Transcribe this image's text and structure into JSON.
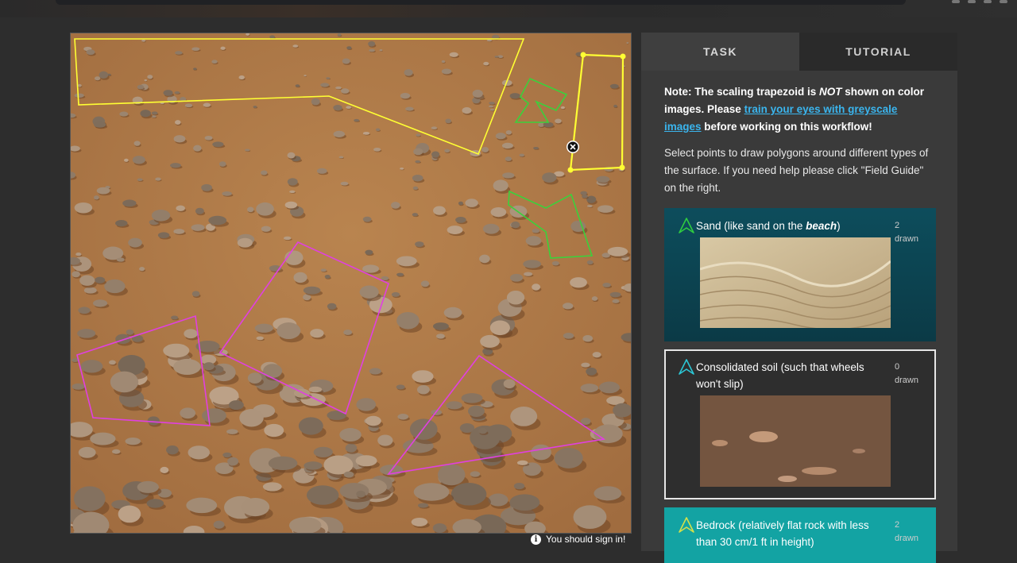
{
  "panel": {
    "tabs": [
      {
        "label": "TASK"
      },
      {
        "label": "TUTORIAL"
      }
    ],
    "note": {
      "prefix": "Note: The scaling trapezoid is ",
      "emphasis": "NOT",
      "middle": " shown on color images. Please ",
      "link": "train your eyes with greyscale images",
      "suffix": " before working on this workflow!"
    },
    "instructions": "Select points to draw polygons around different types of the surface. If you need help please click \"Field Guide\" on the right.",
    "choices": [
      {
        "label_pre": "Sand (like sand on the ",
        "label_em": "beach",
        "label_post": ")",
        "count": "2",
        "count_label": "drawn",
        "color": "#2ecc40"
      },
      {
        "label": "Consolidated soil (such that wheels won't slip)",
        "count": "0",
        "count_label": "drawn",
        "color": "#2bc7d6"
      },
      {
        "label": "Bedrock (relatively flat rock with less than 30 cm/1 ft in height)",
        "count": "2",
        "count_label": "drawn",
        "color": "#d4e04a"
      }
    ]
  },
  "footer": {
    "signin": "You should sign in!"
  },
  "colors": {
    "sand_polygon": "#3bd13b",
    "bedrock_polygon": "#ffff33",
    "rock_polygon": "#e040e0",
    "accent_link": "#3ab5ee"
  }
}
